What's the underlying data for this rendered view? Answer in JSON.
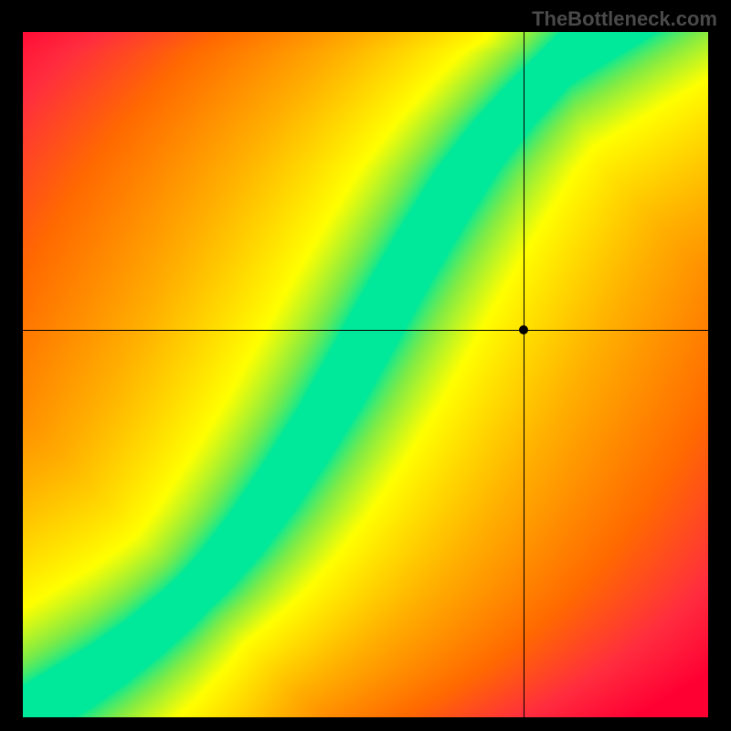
{
  "watermark": "TheBottleneck.com",
  "chart_data": {
    "type": "heatmap",
    "title": "",
    "xlabel": "",
    "ylabel": "",
    "x_range": [
      0,
      1
    ],
    "y_range": [
      0,
      1
    ],
    "crosshair": {
      "x": 0.73,
      "y": 0.565
    },
    "marker": {
      "x": 0.73,
      "y": 0.565
    },
    "optimal_curve": [
      {
        "x": 0.0,
        "y": 0.0
      },
      {
        "x": 0.05,
        "y": 0.03
      },
      {
        "x": 0.1,
        "y": 0.06
      },
      {
        "x": 0.15,
        "y": 0.095
      },
      {
        "x": 0.2,
        "y": 0.135
      },
      {
        "x": 0.25,
        "y": 0.18
      },
      {
        "x": 0.3,
        "y": 0.235
      },
      {
        "x": 0.35,
        "y": 0.3
      },
      {
        "x": 0.4,
        "y": 0.375
      },
      {
        "x": 0.45,
        "y": 0.455
      },
      {
        "x": 0.5,
        "y": 0.545
      },
      {
        "x": 0.55,
        "y": 0.635
      },
      {
        "x": 0.6,
        "y": 0.72
      },
      {
        "x": 0.65,
        "y": 0.8
      },
      {
        "x": 0.7,
        "y": 0.865
      },
      {
        "x": 0.75,
        "y": 0.92
      },
      {
        "x": 0.8,
        "y": 0.97
      },
      {
        "x": 0.85,
        "y": 1.0
      }
    ],
    "color_stops": [
      {
        "t": 0.0,
        "color": "#00e89a"
      },
      {
        "t": 0.1,
        "color": "#80eb45"
      },
      {
        "t": 0.22,
        "color": "#ffff00"
      },
      {
        "t": 0.45,
        "color": "#ffb000"
      },
      {
        "t": 0.68,
        "color": "#ff6a00"
      },
      {
        "t": 0.85,
        "color": "#ff2e3e"
      },
      {
        "t": 1.0,
        "color": "#ff0033"
      }
    ],
    "band_half_width": 0.045,
    "grid": false,
    "legend": false
  }
}
